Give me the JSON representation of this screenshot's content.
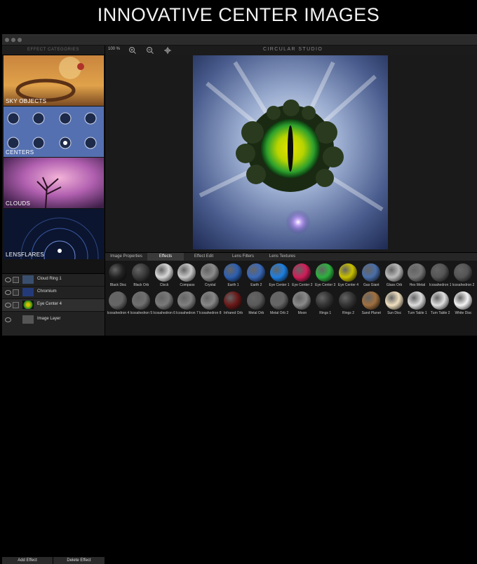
{
  "banner": {
    "title": "INNOVATIVE CENTER IMAGES"
  },
  "sidebar": {
    "header": "EFFECT CATEGORIES",
    "categories": [
      {
        "label": "SKY OBJECTS"
      },
      {
        "label": "CENTERS"
      },
      {
        "label": "CLOUDS"
      },
      {
        "label": "LENSFLARES"
      }
    ]
  },
  "layers": {
    "rows": [
      {
        "label": "Cloud Ring 1"
      },
      {
        "label": "Chromium"
      },
      {
        "label": "Eye Center 4"
      },
      {
        "label": "Image Layer"
      }
    ],
    "add_label": "Add Effect",
    "delete_label": "Delete Effect"
  },
  "toolbar": {
    "zoom": "100 %",
    "brand": "CIRCULAR STUDIO"
  },
  "tabs": [
    "Image Properties",
    "Effects",
    "Effect Edit",
    "Lens Filters",
    "Lens Textures"
  ],
  "effects_row1": [
    "Black Disc",
    "Black Orb",
    "Clock",
    "Compass",
    "Crystal",
    "Earth 1",
    "Earth 2",
    "Eye Center 1",
    "Eye Center 2",
    "Eye Center 3",
    "Eye Center 4",
    "Gas Giant",
    "Glass Orb",
    "Hex Metal",
    "Icosahedron 1",
    "Icosahedron 2",
    "Icosa"
  ],
  "effects_row2": [
    "Icosahedron 4",
    "Icosahedron 5",
    "Icosahedron 6",
    "Icosahedron 7",
    "Icosahedron 8",
    "Infrared Orb",
    "Metal Orb",
    "Metal Orb 2",
    "Moon",
    "Rings 1",
    "Rings 2",
    "Sand Planet",
    "Sun Disc",
    "Turn Table 1",
    "Turn Table 2",
    "White Disc"
  ],
  "colors": {
    "accent": "#3a3a3a",
    "window_bg": "#1b1b1b"
  }
}
